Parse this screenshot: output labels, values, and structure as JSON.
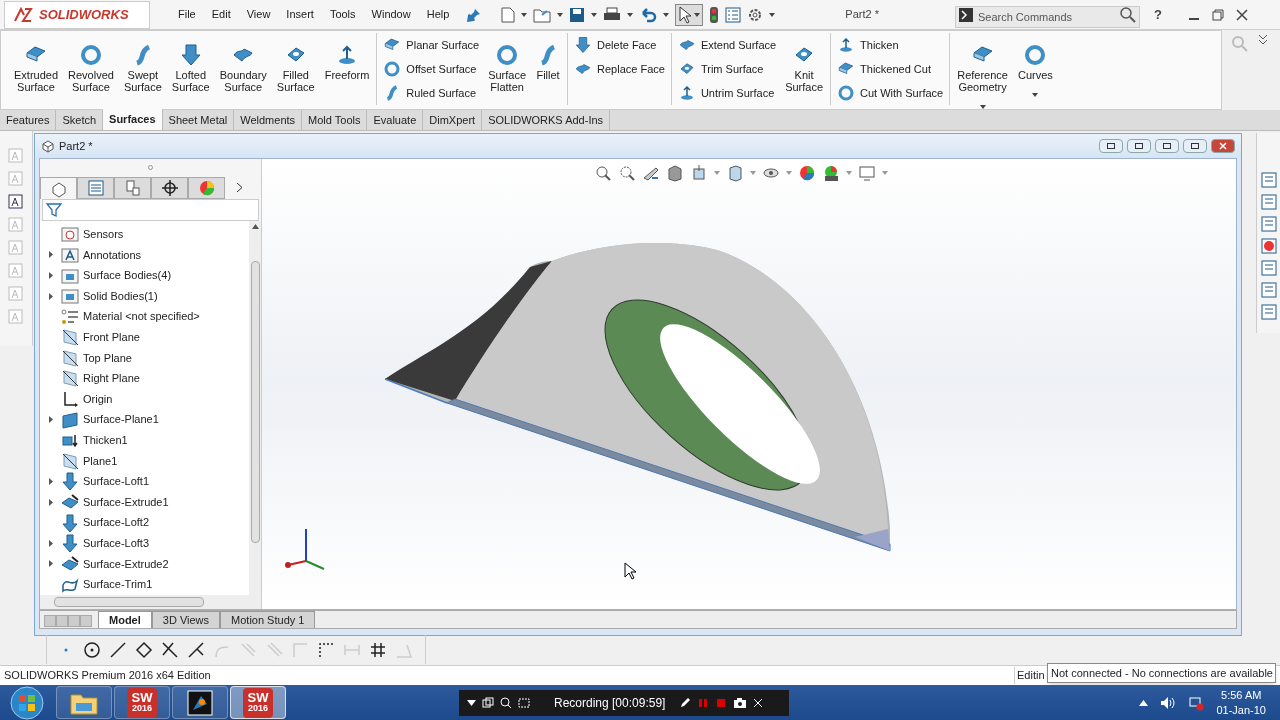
{
  "app": {
    "logo": "SOLIDWORKS",
    "menu": [
      "File",
      "Edit",
      "View",
      "Insert",
      "Tools",
      "Window",
      "Help"
    ],
    "document_title": "Part2 *",
    "search": {
      "placeholder": "Search Commands"
    },
    "help": "?"
  },
  "ribbon": [
    {
      "kind": "large",
      "label": "Extruded Surface",
      "dropdown": false
    },
    {
      "kind": "large",
      "label": "Revolved Surface",
      "dropdown": false
    },
    {
      "kind": "large",
      "label": "Swept Surface",
      "dropdown": false
    },
    {
      "kind": "large",
      "label": "Lofted Surface",
      "dropdown": false
    },
    {
      "kind": "large",
      "label": "Boundary Surface",
      "dropdown": false
    },
    {
      "kind": "large",
      "label": "Filled Surface",
      "dropdown": false
    },
    {
      "kind": "large",
      "label": "Freeform",
      "dropdown": false
    },
    {
      "kind": "separator"
    },
    {
      "kind": "stack",
      "items": [
        "Planar Surface",
        "Offset Surface",
        "Ruled Surface"
      ]
    },
    {
      "kind": "large",
      "label": "Surface Flatten",
      "dropdown": false
    },
    {
      "kind": "large",
      "label": "Fillet",
      "dropdown": false
    },
    {
      "kind": "separator"
    },
    {
      "kind": "stack",
      "items": [
        "Delete Face",
        "Replace Face"
      ]
    },
    {
      "kind": "separator"
    },
    {
      "kind": "stack",
      "items": [
        "Extend Surface",
        "Trim Surface",
        "Untrim Surface"
      ]
    },
    {
      "kind": "large",
      "label": "Knit Surface",
      "dropdown": false
    },
    {
      "kind": "separator"
    },
    {
      "kind": "stack",
      "items": [
        "Thicken",
        "Thickened Cut",
        "Cut With Surface"
      ]
    },
    {
      "kind": "separator"
    },
    {
      "kind": "large",
      "label": "Reference Geometry",
      "dropdown": true
    },
    {
      "kind": "large",
      "label": "Curves",
      "dropdown": true
    }
  ],
  "tabs": [
    {
      "label": "Features",
      "selected": false
    },
    {
      "label": "Sketch",
      "selected": false
    },
    {
      "label": "Surfaces",
      "selected": true
    },
    {
      "label": "Sheet Metal",
      "selected": false
    },
    {
      "label": "Weldments",
      "selected": false
    },
    {
      "label": "Mold Tools",
      "selected": false
    },
    {
      "label": "Evaluate",
      "selected": false
    },
    {
      "label": "DimXpert",
      "selected": false
    },
    {
      "label": "SOLIDWORKS Add-Ins",
      "selected": false
    }
  ],
  "document": {
    "title": "Part2 *"
  },
  "panel_tabs": [
    {
      "selected": true
    },
    {
      "selected": false
    },
    {
      "selected": false
    },
    {
      "selected": false
    },
    {
      "selected": false
    }
  ],
  "tree": {
    "items": [
      {
        "label": "Sensors",
        "kind": "sensor",
        "expandable": false
      },
      {
        "label": "Annotations",
        "kind": "annotation",
        "expandable": true
      },
      {
        "label": "Surface Bodies(4)",
        "kind": "folder",
        "expandable": true
      },
      {
        "label": "Solid Bodies(1)",
        "kind": "folder",
        "expandable": true
      },
      {
        "label": "Material <not specified>",
        "kind": "material",
        "expandable": false
      },
      {
        "label": "Front Plane",
        "kind": "plane",
        "expandable": false
      },
      {
        "label": "Top Plane",
        "kind": "plane",
        "expandable": false
      },
      {
        "label": "Right Plane",
        "kind": "plane",
        "expandable": false
      },
      {
        "label": "Origin",
        "kind": "origin",
        "expandable": false
      },
      {
        "label": "Surface-Plane1",
        "kind": "surface",
        "expandable": true
      },
      {
        "label": "Thicken1",
        "kind": "thicken",
        "expandable": false
      },
      {
        "label": "Plane1",
        "kind": "plane",
        "expandable": false
      },
      {
        "label": "Surface-Loft1",
        "kind": "loft",
        "expandable": true
      },
      {
        "label": "Surface-Extrude1",
        "kind": "extrude",
        "expandable": true
      },
      {
        "label": "Surface-Loft2",
        "kind": "loft",
        "expandable": false
      },
      {
        "label": "Surface-Loft3",
        "kind": "loft",
        "expandable": true
      },
      {
        "label": "Surface-Extrude2",
        "kind": "extrude",
        "expandable": true
      },
      {
        "label": "Surface-Trim1",
        "kind": "trim",
        "expandable": false
      }
    ]
  },
  "bottom_tabs": [
    {
      "label": "Model",
      "selected": true
    },
    {
      "label": "3D Views",
      "selected": false
    },
    {
      "label": "Motion Study 1",
      "selected": false
    }
  ],
  "status_bar": {
    "product": "SOLIDWORKS Premium 2016 x64 Edition",
    "mode": "Editin"
  },
  "tooltip": "Not connected - No connections are available",
  "taskbar": {
    "apps": [
      {
        "kind": "folder",
        "selected": false
      },
      {
        "kind": "solidworks",
        "text": "SW",
        "version": "2016",
        "selected": false
      },
      {
        "kind": "media",
        "selected": false
      },
      {
        "kind": "solidworks",
        "text": "SW",
        "version": "2016",
        "selected": true
      }
    ],
    "recording": "Recording [00:09:59]",
    "time": "5:56 AM",
    "date": "01-Jan-10"
  }
}
